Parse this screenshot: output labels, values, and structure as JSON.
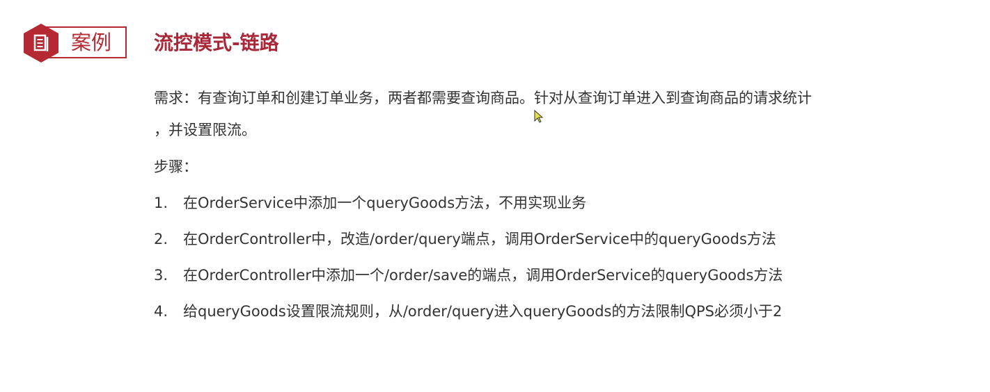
{
  "header": {
    "badge_label": "案例",
    "badge_icon": "document-icon",
    "accent_color": "#b52a32",
    "title": "流控模式-链路"
  },
  "content": {
    "requirement_line1": "需求：有查询订单和创建订单业务，两者都需要查询商品。针对从查询订单进入到查询商品的请求统计",
    "requirement_line2": "，并设置限流。",
    "steps_label": "步骤：",
    "steps": [
      {
        "num": "1.",
        "text": "在OrderService中添加一个queryGoods方法，不用实现业务"
      },
      {
        "num": "2.",
        "text": "在OrderController中，改造/order/query端点，调用OrderService中的queryGoods方法"
      },
      {
        "num": "3.",
        "text": "在OrderController中添加一个/order/save的端点，调用OrderService的queryGoods方法"
      },
      {
        "num": "4.",
        "text": "给queryGoods设置限流规则，从/order/query进入queryGoods的方法限制QPS必须小于2"
      }
    ]
  }
}
